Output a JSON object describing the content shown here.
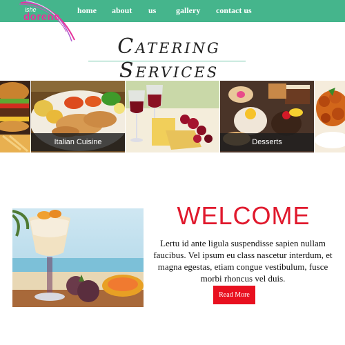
{
  "logo": {
    "top_text": "ishe",
    "main_text": "dorene"
  },
  "nav": {
    "items": [
      {
        "label": "home"
      },
      {
        "label": "about"
      },
      {
        "label": "us"
      },
      {
        "label": "gallery"
      },
      {
        "label": "contact us"
      }
    ]
  },
  "page_title": "Catering Services",
  "gallery": {
    "captions": [
      "Italian Cuisine",
      "Desserts"
    ]
  },
  "welcome": {
    "heading": "WELCOME",
    "body": "Lertu id ante ligula suspendisse sapien nullam faucibus. Vel ipsum eu class nascetur interdum, et magna egestas, etiam congue vestibulum, fusce morbi rhoncus vel duis.",
    "button_label": "Read More"
  },
  "colors": {
    "nav_bg": "#45b58c",
    "accent_red": "#e0192d",
    "logo_pink": "#e8339a"
  }
}
